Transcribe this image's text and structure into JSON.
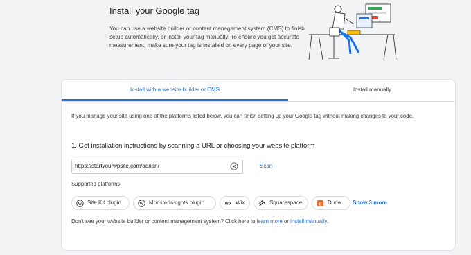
{
  "header": {
    "title": "Install your Google tag",
    "description": "You can use a website builder or content management system (CMS) to finish setup automatically, or install your tag manually. To ensure you get accurate measurement, make sure your tag is installed on every page of your site."
  },
  "tabs": [
    {
      "label": "Install with a website builder or CMS",
      "selected": true
    },
    {
      "label": "Install manually",
      "selected": false
    }
  ],
  "builder": {
    "intro": "If you manage your site using one of the platforms listed below, you can finish setting up your Google tag without making changes to your code.",
    "step1_title": "1. Get installation instructions by scanning a URL or choosing your website platform",
    "url_value": "https://startyourwpsite.com/adrian/",
    "scan_label": "Scan",
    "supported_label": "Supported platforms",
    "platforms": [
      {
        "label": "Site Kit plugin",
        "icon": "wordpress-icon"
      },
      {
        "label": "MonsterInsights plugin",
        "icon": "wordpress-icon"
      },
      {
        "label": "Wix",
        "icon": "wix-icon"
      },
      {
        "label": "Squarespace",
        "icon": "squarespace-icon"
      },
      {
        "label": "Duda",
        "icon": "duda-icon"
      }
    ],
    "show_more_label": "Show 3 more",
    "footer_prefix": "Don't see your website builder or content management system? Click here to",
    "footer_link1": "learn more",
    "footer_or": "or",
    "footer_link2": "install manually",
    "footer_suffix": "."
  },
  "colors": {
    "accent": "#1a73e8",
    "background": "#f1f3f4",
    "card": "#ffffff"
  }
}
